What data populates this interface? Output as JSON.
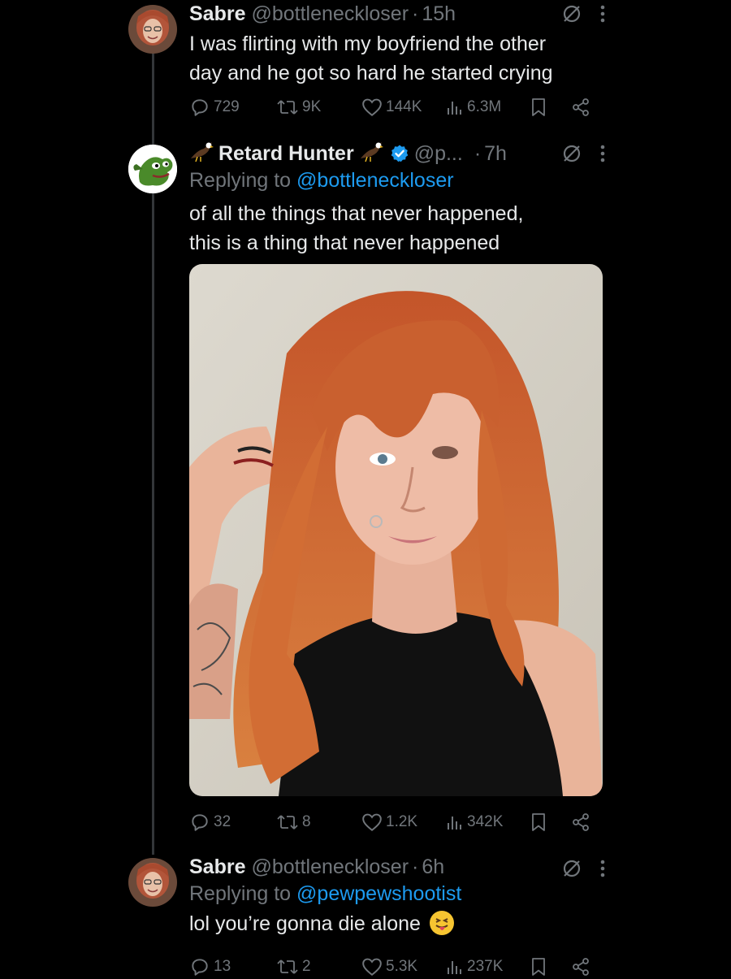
{
  "tweets": [
    {
      "name": "Sabre",
      "handle": "@bottleneckloser",
      "dot": "·",
      "time": "15h",
      "replying_label": "",
      "replying_to": "",
      "text_lines": [
        "I was flirting with my boyfriend the other",
        "day and he got so hard he started crying"
      ],
      "replies": "729",
      "retweets": "9K",
      "likes": "144K",
      "views": "6.3M"
    },
    {
      "name": "Retard Hunter",
      "handle": "@p...",
      "dot": "·",
      "time": "7h",
      "replying_label": "Replying to",
      "replying_to": "@bottleneckloser",
      "text_lines": [
        "of all the things that never happened,",
        "this is a thing that never happened"
      ],
      "replies": "32",
      "retweets": "8",
      "likes": "1.2K",
      "views": "342K"
    },
    {
      "name": "Sabre",
      "handle": "@bottleneckloser",
      "dot": "·",
      "time": "6h",
      "replying_label": "Replying to",
      "replying_to": "@pewpewshootist",
      "text": "lol you’re gonna die alone",
      "replies": "13",
      "retweets": "2",
      "likes": "5.3K",
      "views": "237K"
    }
  ],
  "colors": {
    "background": "#000000",
    "text": "#e7e9ea",
    "muted": "#71767b",
    "link": "#1d9bf0",
    "verified": "#1d9bf0"
  },
  "icons": [
    "reply-icon",
    "retweet-icon",
    "like-icon",
    "views-icon",
    "bookmark-icon",
    "share-icon",
    "muted-icon",
    "more-icon",
    "verified-badge-icon",
    "eagle-emoji",
    "tongue-emoji"
  ]
}
